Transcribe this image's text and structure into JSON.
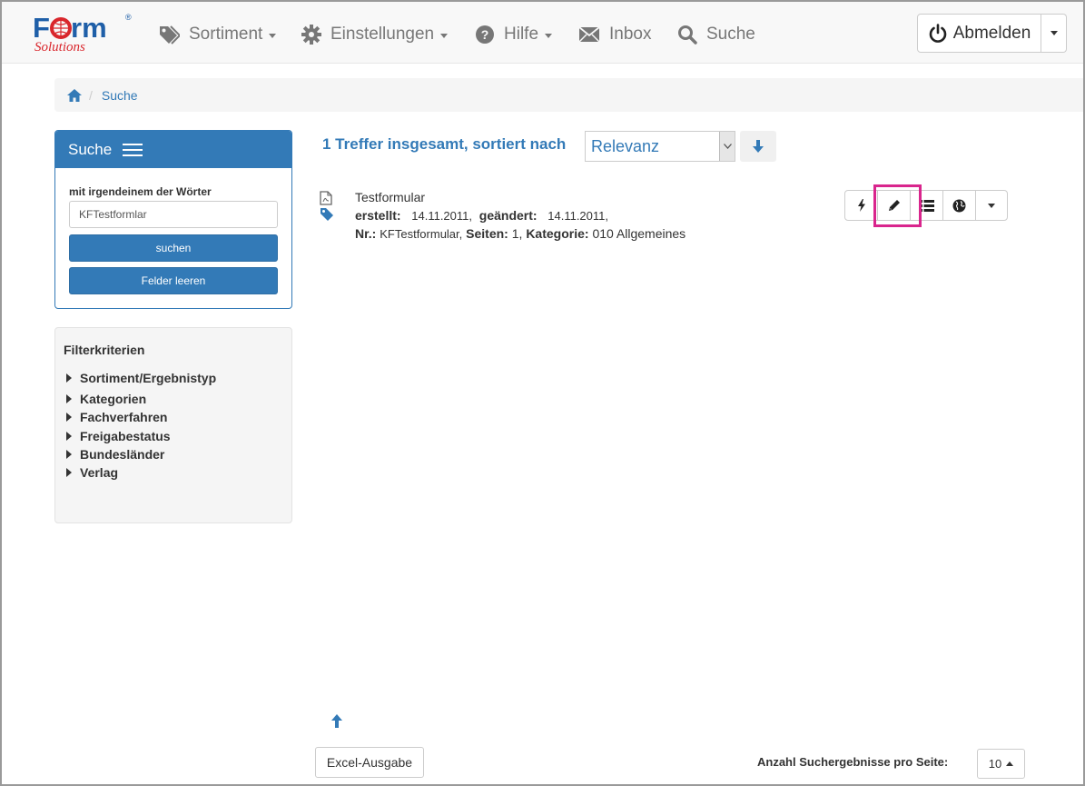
{
  "brand": {
    "logo_main": "Form",
    "logo_sub": "Solutions",
    "logo_mark": "®"
  },
  "nav": {
    "sortiment": "Sortiment",
    "einstellungen": "Einstellungen",
    "hilfe": "Hilfe",
    "inbox": "Inbox",
    "suche": "Suche",
    "logout": "Abmelden"
  },
  "breadcrumb": {
    "current": "Suche"
  },
  "search_panel": {
    "title": "Suche",
    "field_label": "mit irgendeinem der Wörter",
    "field_value": "KFTestformlar",
    "search_button": "suchen",
    "clear_button": "Felder leeren"
  },
  "filters": {
    "title": "Filterkriterien",
    "items": [
      "Sortiment/Ergebnistyp",
      "Kategorien",
      "Fachverfahren",
      "Freigabestatus",
      "Bundesländer",
      "Verlag"
    ]
  },
  "results": {
    "summary": "1 Treffer insgesamt, sortiert nach",
    "sort_value": "Relevanz",
    "item": {
      "title": "Testformular",
      "created_label": "erstellt:",
      "created": "14.11.2011,",
      "changed_label": "geändert:",
      "changed": "14.11.2011,",
      "nr_label": "Nr.:",
      "nr": "KFTestformular,",
      "pages_label": "Seiten:",
      "pages": "1,",
      "category_label": "Kategorie:",
      "category": "010 Allgemeines"
    }
  },
  "footer": {
    "excel": "Excel-Ausgabe",
    "per_page_label": "Anzahl Suchergebnisse pro Seite:",
    "per_page_value": "10"
  },
  "colors": {
    "primary": "#337ab7",
    "highlight": "#d9258d",
    "logo_red": "#d9262c"
  }
}
